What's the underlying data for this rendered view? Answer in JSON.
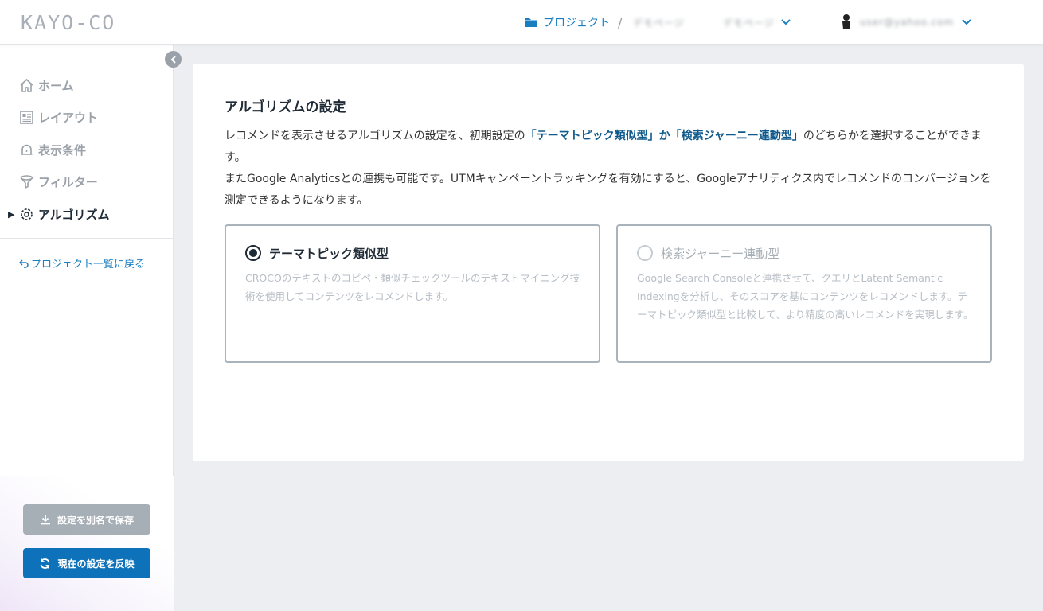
{
  "header": {
    "logo": "KAYO-CO",
    "breadcrumb_project": "プロジェクト",
    "breadcrumb_sep": "/",
    "breadcrumb_sub": "デモページ",
    "dropdown_label": "デモページ",
    "user_email": "user@yahoo.com"
  },
  "sidebar": {
    "items": [
      {
        "label": "ホーム",
        "icon": "home-icon"
      },
      {
        "label": "レイアウト",
        "icon": "layout-icon"
      },
      {
        "label": "表示条件",
        "icon": "bell-icon"
      },
      {
        "label": "フィルター",
        "icon": "filter-icon"
      },
      {
        "label": "アルゴリズム",
        "icon": "gear-icon",
        "active": true
      }
    ],
    "back_link": "プロジェクト一覧に戻る",
    "save_as_label": "設定を別名で保存",
    "apply_label": "現在の設定を反映"
  },
  "main": {
    "title": "アルゴリズムの設定",
    "desc_line1_a": "レコメンドを表示させるアルゴリズムの設定を、初期設定の",
    "desc_line1_hl": "「テーマトピック類似型」か「検索ジャーニー連動型」",
    "desc_line1_b": "のどちらかを選択することができます。",
    "desc_line2": "またGoogle Analyticsとの連携も可能です。UTMキャンペーントラッキングを有効にすると、Googleアナリティクス内でレコメンドのコンバージョンを測定できるようになります。",
    "options": [
      {
        "title": "テーマトピック類似型",
        "desc": "CROCOのテキストのコピペ・類似チェックツールのテキストマイニング技術を使用してコンテンツをレコメンドします。",
        "selected": true
      },
      {
        "title": "検索ジャーニー連動型",
        "desc": "Google Search Consoleと連携させて、クエリとLatent Semantic Indexingを分析し、そのスコアを基にコンテンツをレコメンドします。テーマトピック類似型と比較して、より精度の高いレコメンドを実現します。",
        "selected": false
      }
    ]
  },
  "colors": {
    "accent": "#1a7dc0",
    "primary_button": "#0d72b9",
    "disabled_button": "#a7afb6",
    "text_dark": "#1e2a35"
  }
}
